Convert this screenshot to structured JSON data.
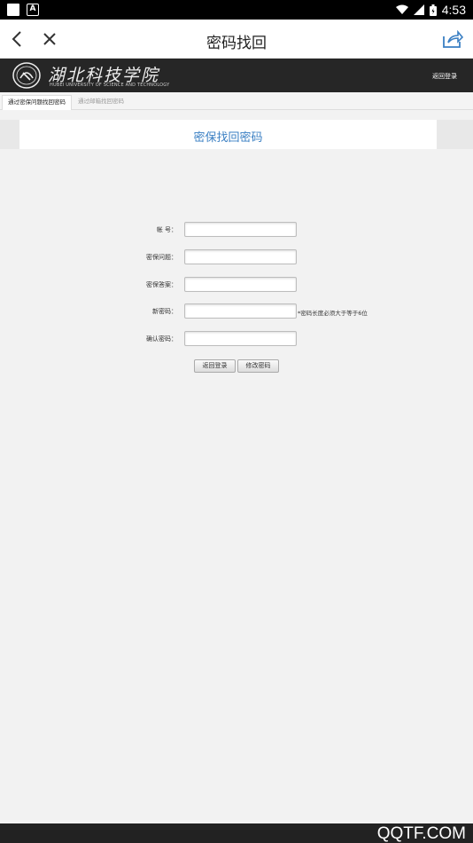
{
  "status_bar": {
    "time": "4:53",
    "icons": [
      "notification-square-icon",
      "a-badge-icon",
      "wifi-icon",
      "signal-icon",
      "battery-icon"
    ]
  },
  "topbar": {
    "title": "密码找回",
    "back_icon": "back-arrow-icon",
    "close_icon": "close-icon",
    "share_icon": "share-icon"
  },
  "banner": {
    "logo_cn": "湖北科技学院",
    "logo_en": "HUBEI UNIVERSITY OF SCIENCE AND TECHNOLOGY",
    "login_link": "返回登录"
  },
  "tabs": [
    {
      "label": "通过密保问题找回密码",
      "active": true
    },
    {
      "label": "通过邮箱找回密码",
      "active": false
    }
  ],
  "section": {
    "title": "密保找回密码"
  },
  "form": {
    "account_label": "帐 号：",
    "account_value": "",
    "question_label": "密保问题：",
    "question_value": "",
    "answer_label": "密保答案：",
    "answer_value": "",
    "new_password_label": "新密码：",
    "new_password_value": "",
    "new_password_hint": "*密码长度必须大于等于6位",
    "confirm_label": "确认密码：",
    "confirm_value": ""
  },
  "buttons": {
    "back_login": "返回登录",
    "change_password": "修改密码"
  },
  "watermark": "QQTF.COM",
  "colors": {
    "accent": "#3a7fc3",
    "banner_bg": "#262626",
    "page_bg": "#f2f2f2"
  }
}
